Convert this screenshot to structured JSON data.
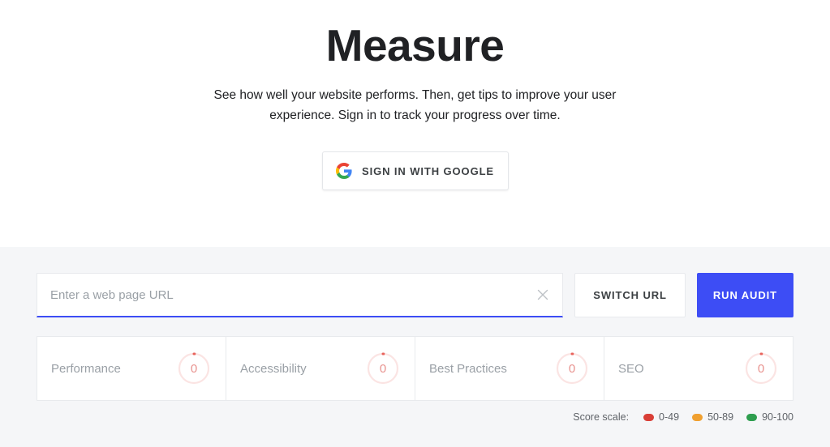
{
  "hero": {
    "title": "Measure",
    "subtitle": "See how well your website performs. Then, get tips to improve your user experience. Sign in to track your progress over time.",
    "signin_label": "SIGN IN WITH GOOGLE",
    "signin_icon": "google-g-icon"
  },
  "audit": {
    "url_value": "",
    "url_placeholder": "Enter a web page URL",
    "clear_icon": "close-icon",
    "switch_url_label": "SWITCH URL",
    "run_audit_label": "RUN AUDIT",
    "accent_color": "#3d4df5"
  },
  "scores": [
    {
      "label": "Performance",
      "value": "0"
    },
    {
      "label": "Accessibility",
      "value": "0"
    },
    {
      "label": "Best Practices",
      "value": "0"
    },
    {
      "label": "SEO",
      "value": "0"
    }
  ],
  "legend": {
    "label": "Score scale:",
    "items": [
      {
        "range": "0-49",
        "color": "#d93f37"
      },
      {
        "range": "50-89",
        "color": "#f0a030"
      },
      {
        "range": "90-100",
        "color": "#2e9e4f"
      }
    ]
  }
}
